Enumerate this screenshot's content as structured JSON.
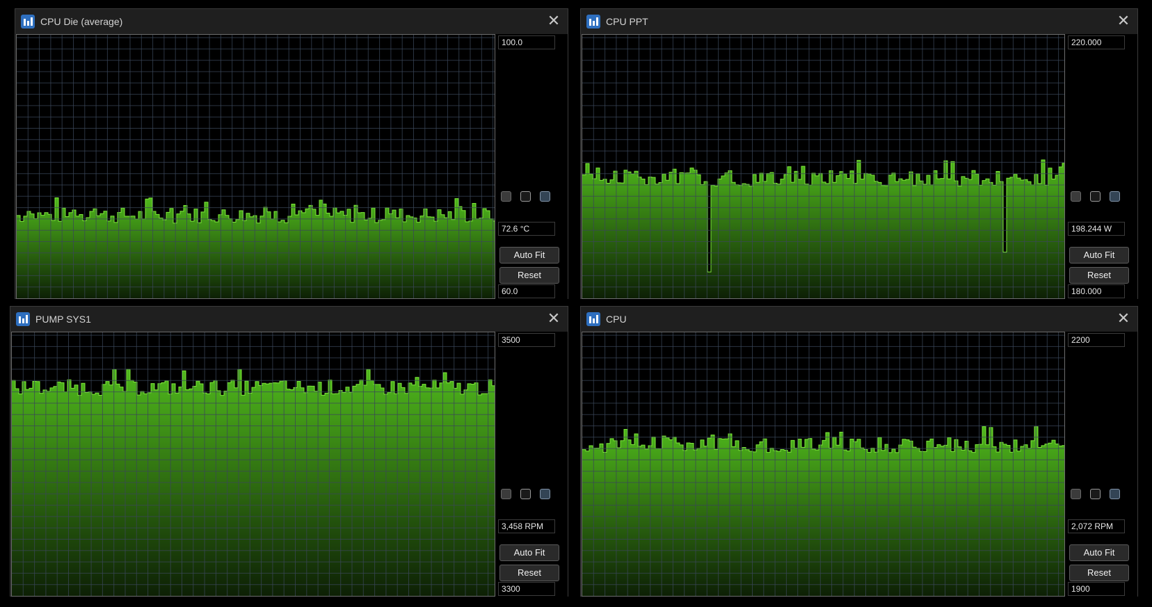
{
  "colors": {
    "grid": "#3a4658",
    "line": "#7ee63a",
    "fill_top": "#4fb81c",
    "fill_bottom": "#0d2005",
    "background": "#000000"
  },
  "icons": {
    "app": "hwinfo-graph-icon",
    "close": "close-icon"
  },
  "windows": [
    {
      "title": "CPU Die (average)",
      "max_value": "100.0",
      "min_value": "60.0",
      "current_value": "72.6 °C",
      "auto_fit_label": "Auto Fit",
      "reset_label": "Reset",
      "chart_data": {
        "type": "area",
        "ylim": [
          60,
          100
        ],
        "level": 72.6,
        "dips": []
      }
    },
    {
      "title": "CPU PPT",
      "max_value": "220.000",
      "min_value": "180.000",
      "current_value": "198.244 W",
      "auto_fit_label": "Auto Fit",
      "reset_label": "Reset",
      "chart_data": {
        "type": "area",
        "ylim": [
          180,
          220
        ],
        "level": 198.2,
        "dips": [
          184,
          187
        ]
      }
    },
    {
      "title": "PUMP SYS1",
      "max_value": "3500",
      "min_value": "3300",
      "current_value": "3,458 RPM",
      "auto_fit_label": "Auto Fit",
      "reset_label": "Reset",
      "chart_data": {
        "type": "area",
        "ylim": [
          3300,
          3500
        ],
        "level": 3458,
        "dips": []
      }
    },
    {
      "title": "CPU",
      "max_value": "2200",
      "min_value": "1900",
      "current_value": "2,072 RPM",
      "auto_fit_label": "Auto Fit",
      "reset_label": "Reset",
      "chart_data": {
        "type": "area",
        "ylim": [
          1900,
          2200
        ],
        "level": 2072,
        "dips": []
      }
    }
  ]
}
